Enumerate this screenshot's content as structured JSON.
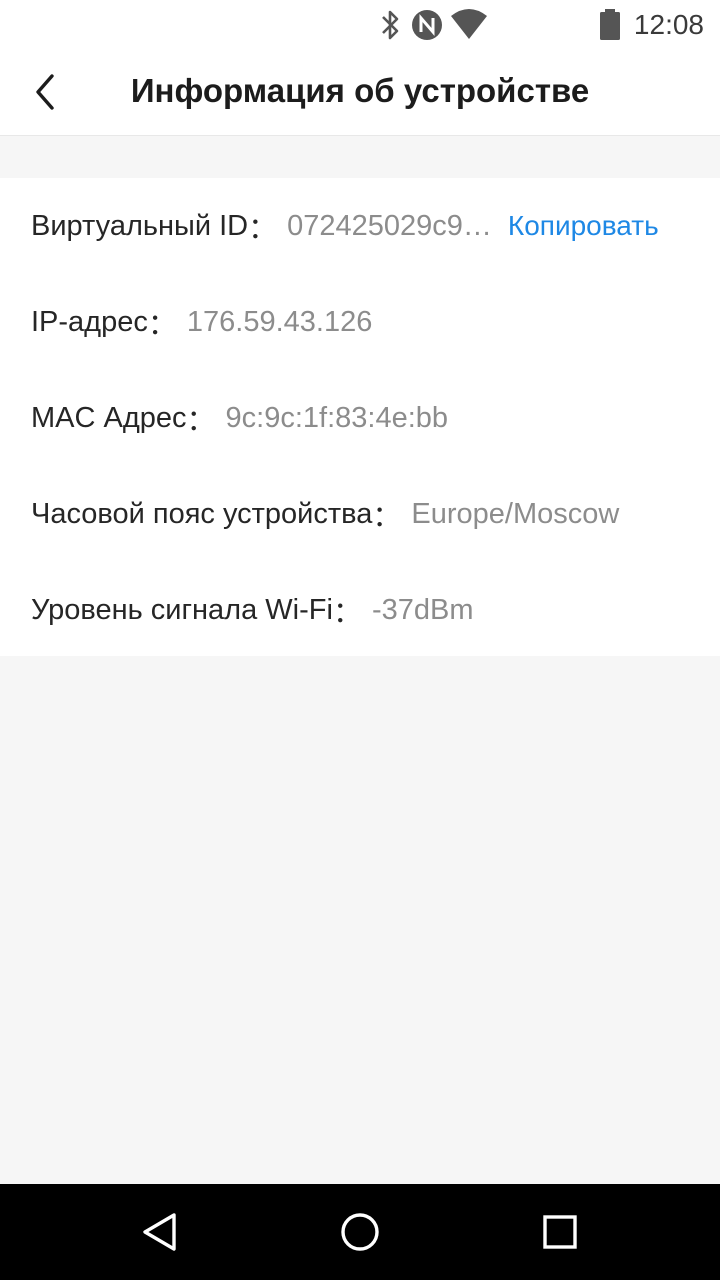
{
  "status_bar": {
    "time": "12:08",
    "icons": [
      "bluetooth-icon",
      "nfc-icon",
      "wifi-icon",
      "battery-icon"
    ]
  },
  "header": {
    "title": "Информация об устройстве",
    "back_icon": "chevron-left-icon"
  },
  "device_info": [
    {
      "label": "Виртуальный ID",
      "value": "072425029c9…",
      "action": "Копировать"
    },
    {
      "label": "IP-адрес",
      "value": "176.59.43.126"
    },
    {
      "label": "MAC Адрес",
      "value": "9c:9c:1f:83:4e:bb"
    },
    {
      "label": "Часовой пояс устройства",
      "value": "Europe/Moscow"
    },
    {
      "label": "Уровень сигнала Wi-Fi",
      "value": "-37dBm"
    }
  ],
  "separator": "：",
  "colors": {
    "accent": "#1e88e5",
    "label": "#262626",
    "value": "#8c8c8c",
    "background": "#f6f6f6"
  },
  "nav_bar": {
    "icons": [
      "back-triangle-icon",
      "home-circle-icon",
      "recents-square-icon"
    ]
  }
}
